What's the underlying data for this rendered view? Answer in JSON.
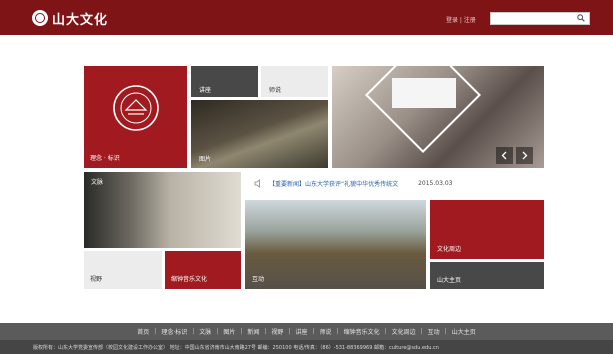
{
  "header": {
    "logo_text": "山大文化",
    "auth_text": "登录 | 注册",
    "search_placeholder": ""
  },
  "tiles": {
    "philosophy": "理念 · 标识",
    "lecture": "讲座",
    "masters": "师说",
    "pictures": "图片",
    "literature": "文脉",
    "vision": "视野",
    "classical_music": "缩钟音乐文化",
    "interaction": "互动",
    "culture_weekly": "文化周边",
    "sdu_home": "山大主页"
  },
  "news": {
    "headline": "【重要新闻】山东大学获评“礼貌中华优秀传统文",
    "date": "2015.03.03"
  },
  "nav": [
    "首页",
    "理念·标识",
    "文脉",
    "图片",
    "新闻",
    "视野",
    "讲座",
    "师说",
    "缩钟音乐文化",
    "文化周边",
    "互动",
    "山大主页"
  ],
  "footer": {
    "text": "版权所有：山东大学党委宣传部（校园文化建设工作办公室）    地址：中国山东省济南市山大南路27号    邮编：250100    电话/传真：（86）-531-88369969    邮箱：culture@sdu.edu.cn"
  },
  "colors": {
    "brand": "#7f1416",
    "tile_red": "#a01a1f",
    "tile_dark": "#484848",
    "link": "#2b61a8"
  }
}
